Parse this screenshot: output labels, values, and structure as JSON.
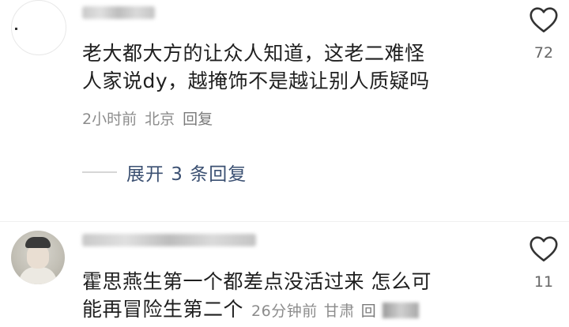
{
  "comments": [
    {
      "text_lines": [
        "老大都大方的让众人知道，这老二难怪",
        "人家说dy，越掩饰不是越让别人质疑吗"
      ],
      "time": "2小时前",
      "location": "北京",
      "reply_label": "回复",
      "likes": "72",
      "expand_label": "展开 3 条回复"
    },
    {
      "text_lines": [
        "霍思燕生第一个都差点没活过来  怎么可",
        "能再冒险生第二个"
      ],
      "time": "26分钟前",
      "location": "甘肃",
      "reply_label": "回",
      "likes": "11"
    }
  ],
  "icons": {
    "like": "heart-outline-icon"
  },
  "colors": {
    "text": "#1f1f1f",
    "meta": "#8c8c8c",
    "expand_link": "#3b5072"
  }
}
